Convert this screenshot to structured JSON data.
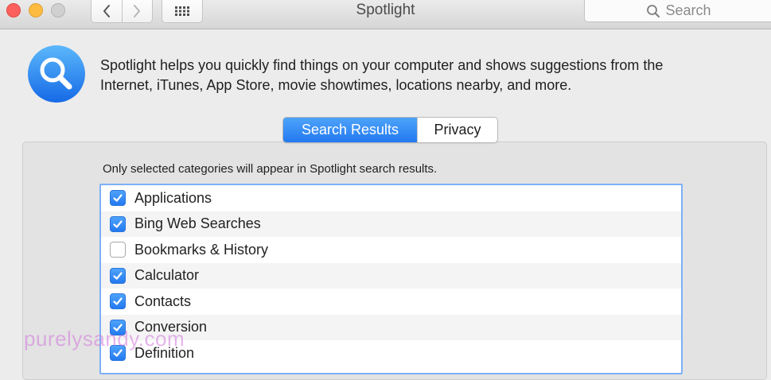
{
  "window": {
    "title": "Spotlight",
    "search_placeholder": "Search"
  },
  "header": {
    "icon": "spotlight-magnifier-icon",
    "description_line1": "Spotlight helps you quickly find things on your computer and shows suggestions from the",
    "description_line2": "Internet, iTunes, App Store, movie showtimes, locations nearby, and more."
  },
  "tabs": [
    {
      "label": "Search Results",
      "selected": true
    },
    {
      "label": "Privacy",
      "selected": false
    }
  ],
  "note": "Only selected categories will appear in Spotlight search results.",
  "categories": [
    {
      "label": "Applications",
      "checked": true
    },
    {
      "label": "Bing Web Searches",
      "checked": true
    },
    {
      "label": "Bookmarks & History",
      "checked": false
    },
    {
      "label": "Calculator",
      "checked": true
    },
    {
      "label": "Contacts",
      "checked": true
    },
    {
      "label": "Conversion",
      "checked": true
    },
    {
      "label": "Definition",
      "checked": true
    }
  ],
  "watermark": "purelysandy.com",
  "colors": {
    "accent": "#2f8af5",
    "close": "#fc605c",
    "minimize": "#fdbc40",
    "zoom_disabled": "#d0d0d0"
  }
}
